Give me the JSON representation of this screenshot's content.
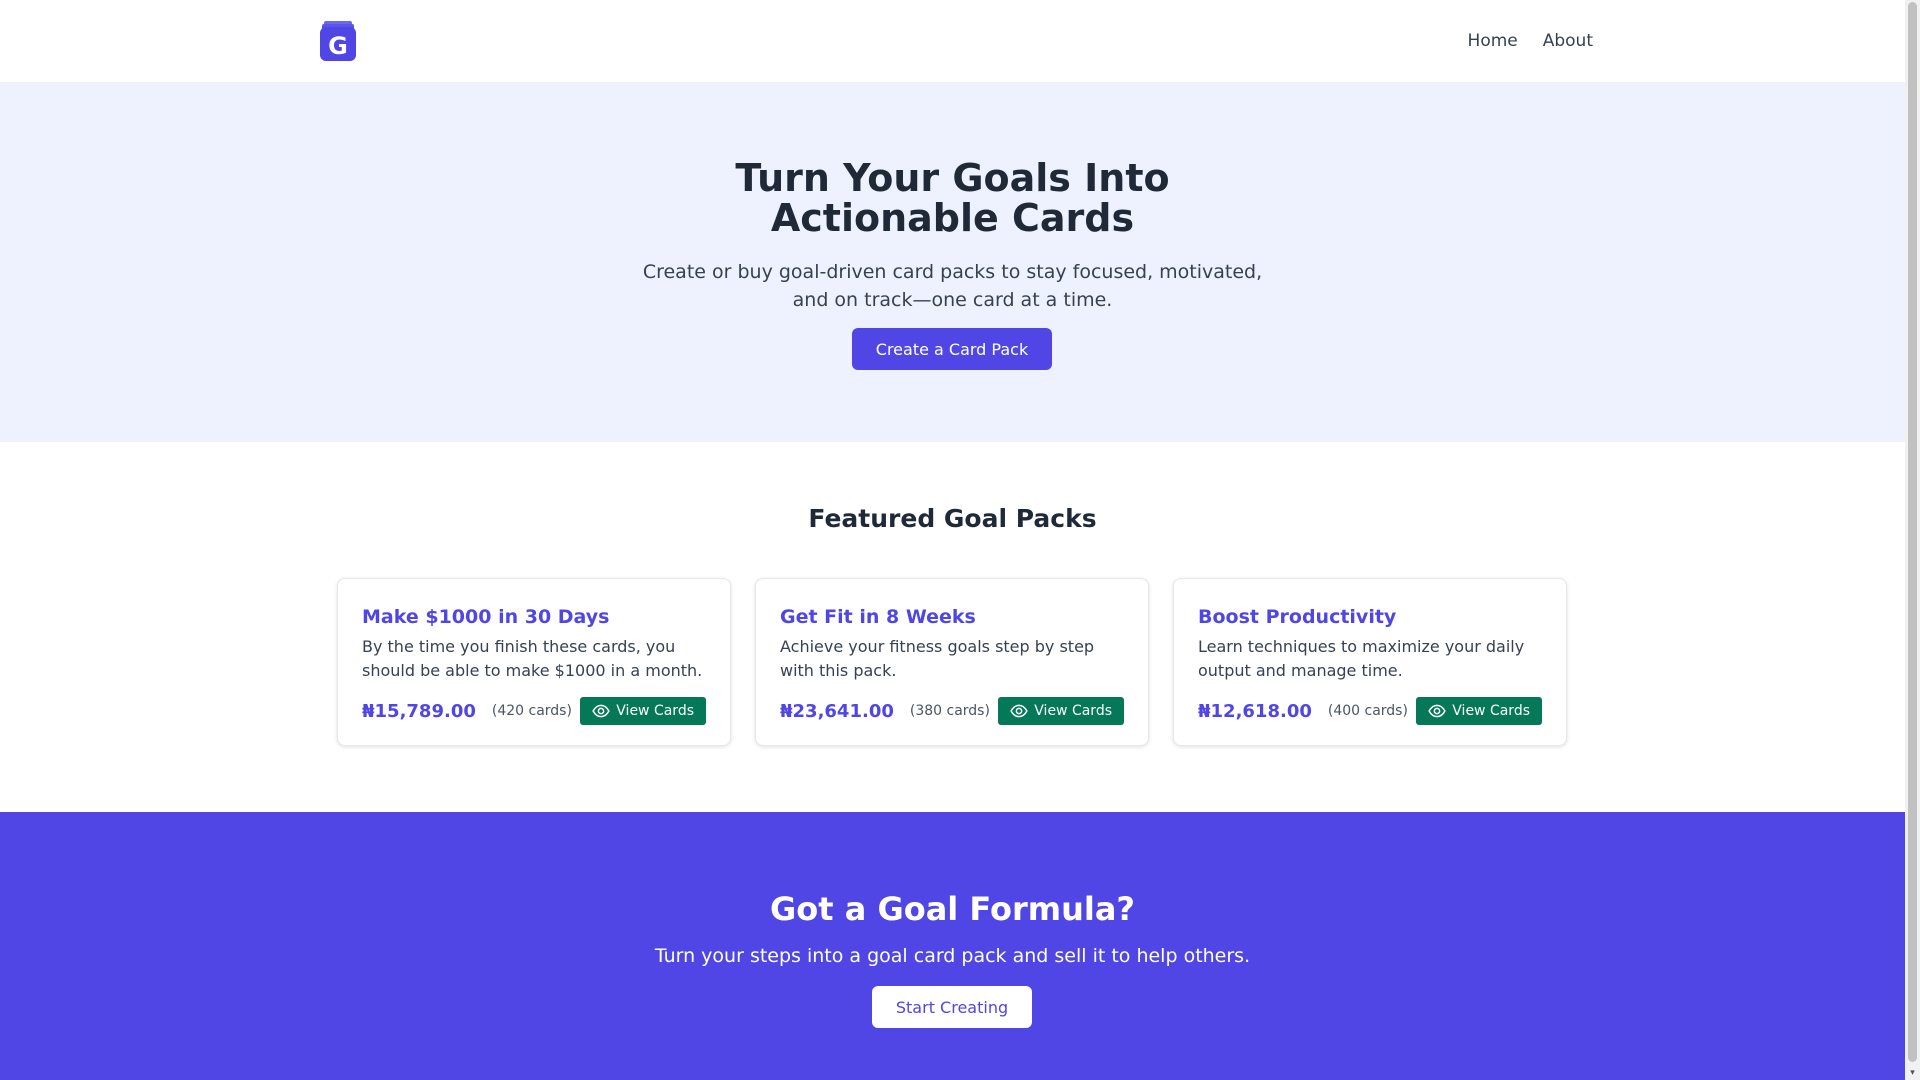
{
  "header": {
    "logo_letter": "G",
    "nav": [
      {
        "label": "Home"
      },
      {
        "label": "About"
      }
    ]
  },
  "hero": {
    "title_line1": "Turn Your Goals Into",
    "title_line2": "Actionable Cards",
    "subtitle": "Create or buy goal-driven card packs to stay focused, motivated, and on track—one card at a time.",
    "cta_label": "Create a Card Pack"
  },
  "featured": {
    "heading": "Featured Goal Packs",
    "packs": [
      {
        "title": "Make $1000 in 30 Days",
        "description": "By the time you finish these cards, you should be able to make $1000 in a month.",
        "price": "₦15,789.00",
        "count": "(420 cards)",
        "button_label": "View Cards"
      },
      {
        "title": "Get Fit in 8 Weeks",
        "description": "Achieve your fitness goals step by step with this pack.",
        "price": "₦23,641.00",
        "count": "(380 cards)",
        "button_label": "View Cards"
      },
      {
        "title": "Boost Productivity",
        "description": "Learn techniques to maximize your daily output and manage time.",
        "price": "₦12,618.00",
        "count": "(400 cards)",
        "button_label": "View Cards"
      }
    ]
  },
  "cta": {
    "heading": "Got a Goal Formula?",
    "text": "Turn your steps into a goal card pack and sell it to help others.",
    "button_label": "Start Creating"
  },
  "colors": {
    "brand": "#4f46e5",
    "hero_bg": "#eef2ff",
    "view_button": "#047857"
  },
  "icons": {
    "logo": "card-stack-g-logo",
    "view": "eye-icon"
  }
}
